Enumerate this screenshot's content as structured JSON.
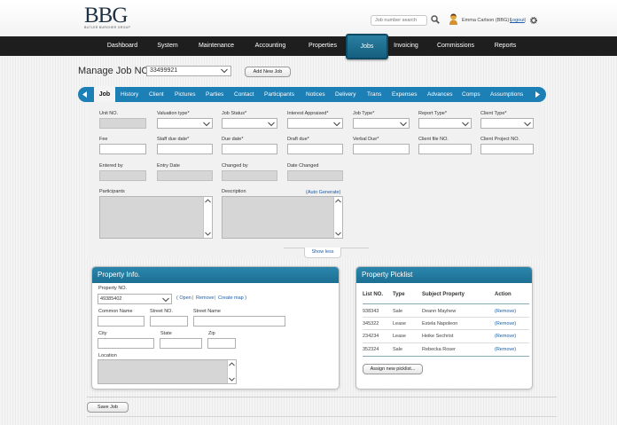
{
  "header": {
    "logo": "BBG",
    "logo_subtitle": "BUTLER BURGHER GROUP",
    "search_placeholder": "Job number search",
    "user_name": "Emma Carlson (BBG) |",
    "logout": "Logout",
    "separator": "|"
  },
  "nav": {
    "items": [
      "Dashboard",
      "System",
      "Maintenance",
      "Accounting",
      "Properties",
      "Jobs",
      "Invoicing",
      "Commissions",
      "Reports"
    ],
    "active": "Jobs"
  },
  "manage": {
    "title": "Manage Job NO.",
    "job_no": "33499921",
    "add_button": "Add New Job"
  },
  "tabs": [
    "Job",
    "History",
    "Client",
    "Pictures",
    "Parties",
    "Contact",
    "Participants",
    "Notices",
    "Delivery",
    "Trans",
    "Expenses",
    "Advances",
    "Comps",
    "Assumptions"
  ],
  "form": {
    "row1": [
      "Unit NO.",
      "Valuation type*",
      "Job Status*",
      "Interest Appraised*",
      "Job Type*",
      "Report Type*",
      "Client Type*"
    ],
    "row2": [
      "Fee",
      "Staff due date*",
      "Due date*",
      "Draft due*",
      "Verbal Due*",
      "Client file NO.",
      "Client Project NO."
    ],
    "row3": [
      "Entered by",
      "Entry Date",
      "Changed by",
      "Date Changed"
    ],
    "participants_label": "Participants",
    "description_label": "Description",
    "auto_generate": "(Auto Generate)",
    "show_less": "Show less"
  },
  "property_info": {
    "title": "Property Info.",
    "property_no_label": "Property NO.",
    "property_no": "49385402",
    "links": [
      "( Open",
      "|",
      "Remove",
      "|",
      "Create map )"
    ],
    "common_name": "Common Name",
    "street_no": "Street NO.",
    "street_name": "Street Name",
    "city": "City",
    "state": "State",
    "zip": "Zip",
    "location": "Location"
  },
  "picklist": {
    "title": "Property Picklist",
    "headers": [
      "List NO.",
      "Type",
      "Subject Property",
      "Action"
    ],
    "rows": [
      {
        "list_no": "938343",
        "type": "Sale",
        "subject": "Deann Mayhew",
        "action": "(Remove)"
      },
      {
        "list_no": "345322",
        "type": "Lease",
        "subject": "Estela Napoleon",
        "action": "(Remove)"
      },
      {
        "list_no": "234234",
        "type": "Lease",
        "subject": "Heike Sechrist",
        "action": "(Remove)"
      },
      {
        "list_no": "352324",
        "type": "Sale",
        "subject": "Rebecka Roser",
        "action": "(Remove)"
      }
    ],
    "assign_button": "Assign new picklist..."
  },
  "footer": {
    "save_button": "Save Job"
  },
  "colors": {
    "accent": "#1c7fb5",
    "nav_bg": "#1e1e1e",
    "panel_head": "#2280a8",
    "link": "#1a5da8"
  }
}
